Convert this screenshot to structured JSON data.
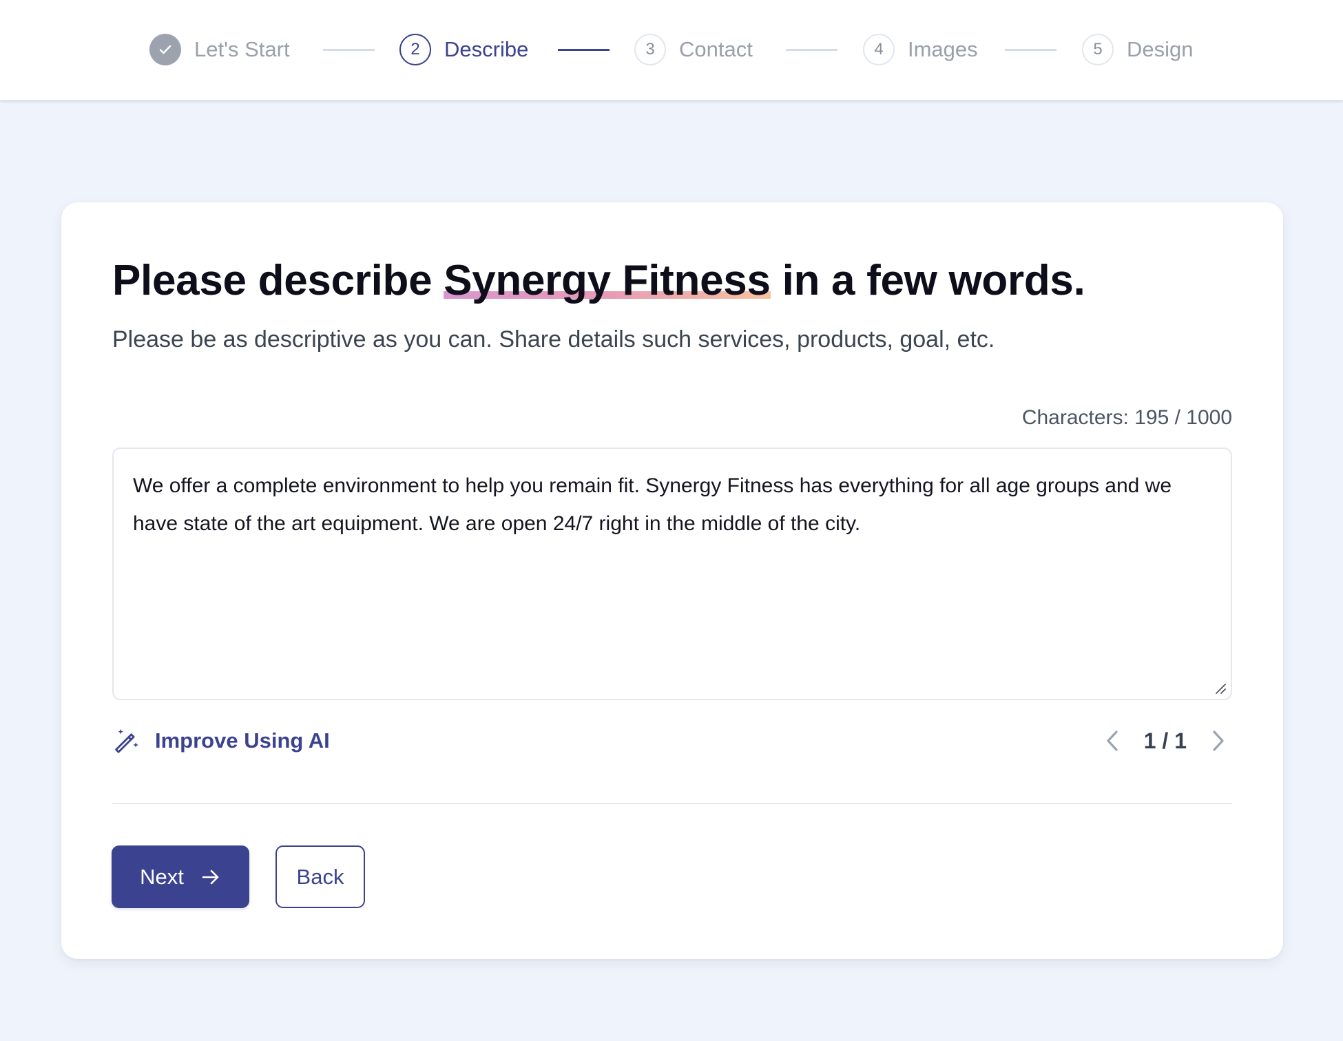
{
  "stepper": {
    "steps": [
      {
        "number": "✓",
        "label": "Let's Start",
        "state": "done"
      },
      {
        "number": "2",
        "label": "Describe",
        "state": "active"
      },
      {
        "number": "3",
        "label": "Contact",
        "state": "todo"
      },
      {
        "number": "4",
        "label": "Images",
        "state": "todo"
      },
      {
        "number": "5",
        "label": "Design",
        "state": "todo"
      }
    ]
  },
  "form": {
    "title_prefix": "Please describe ",
    "business_name": "Synergy Fitness",
    "title_suffix": " in a few words.",
    "subtitle": "Please be as descriptive as you can. Share details such services, products, goal, etc.",
    "char_count_label": "Characters: 195 / 1000",
    "char_count": 195,
    "char_limit": 1000,
    "description_value": "We offer a complete environment to help you remain fit. Synergy Fitness has everything for all age groups and we have state of the art equipment. We are open 24/7 right in the middle of the city.",
    "improve_label": "Improve Using AI",
    "improve_icon": "magic-wand-icon",
    "pager_text": "1 / 1"
  },
  "actions": {
    "next_label": "Next",
    "next_icon": "arrow-right-icon",
    "back_label": "Back"
  },
  "colors": {
    "accent": "#3b4390",
    "background": "#eff3fb",
    "highlight_gradient": [
      "#d796cf",
      "#e89bb5",
      "#f5c39e"
    ]
  }
}
